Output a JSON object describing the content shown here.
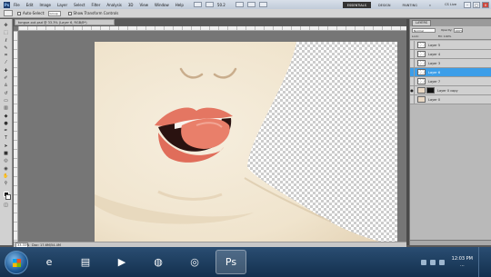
{
  "menubar": {
    "logo": "Ps",
    "items": [
      "File",
      "Edit",
      "Image",
      "Layer",
      "Select",
      "Filter",
      "Analysis",
      "3D",
      "View",
      "Window",
      "Help"
    ],
    "zoom": "50.2",
    "workspaces": [
      "ESSENTIALS",
      "DESIGN",
      "PAINTING"
    ],
    "cs_live": "CS Live"
  },
  "options": {
    "auto_select_label": "Auto-Select:",
    "auto_select_value": "Group",
    "transform_label": "Show Transform Controls"
  },
  "document": {
    "tab_title": "tongue-out-psd @ 33.3% (Layer 6, RGB/8*)",
    "status_zoom": "33.33%",
    "status_doc": "Doc: 17.6M/54.4M"
  },
  "layers_panel": {
    "tab_label": "LAYERS",
    "blend_mode": "Normal",
    "opacity_label": "Opacity:",
    "opacity_value": "100%",
    "lock_label": "Lock:",
    "fill_label": "Fill: 100%",
    "layers": [
      {
        "name": "Layer 5",
        "visible": false,
        "selected": false,
        "thumb": "checker",
        "mask": false
      },
      {
        "name": "Layer 4",
        "visible": false,
        "selected": false,
        "thumb": "checker",
        "mask": false
      },
      {
        "name": "Layer 3",
        "visible": false,
        "selected": false,
        "thumb": "checker",
        "mask": false
      },
      {
        "name": "Layer 6",
        "visible": false,
        "selected": true,
        "thumb": "checker",
        "mask": false
      },
      {
        "name": "Layer 7",
        "visible": false,
        "selected": false,
        "thumb": "checker",
        "mask": false
      },
      {
        "name": "Layer 0 copy",
        "visible": true,
        "selected": false,
        "thumb": "face",
        "mask": true
      },
      {
        "name": "Layer 0",
        "visible": false,
        "selected": false,
        "thumb": "face",
        "mask": false
      }
    ]
  },
  "taskbar": {
    "apps": [
      "ie-icon",
      "folder-icon",
      "media-icon",
      "firefox-icon",
      "chrome-icon",
      "photoshop-icon"
    ],
    "active_app": "photoshop-icon",
    "time": "12:03 PM",
    "date": "..."
  },
  "colors": {
    "skin": "#f1e7d4",
    "lips": "#e2745f",
    "tongue": "#e97f6a",
    "selected_layer": "#3c9ee8"
  }
}
